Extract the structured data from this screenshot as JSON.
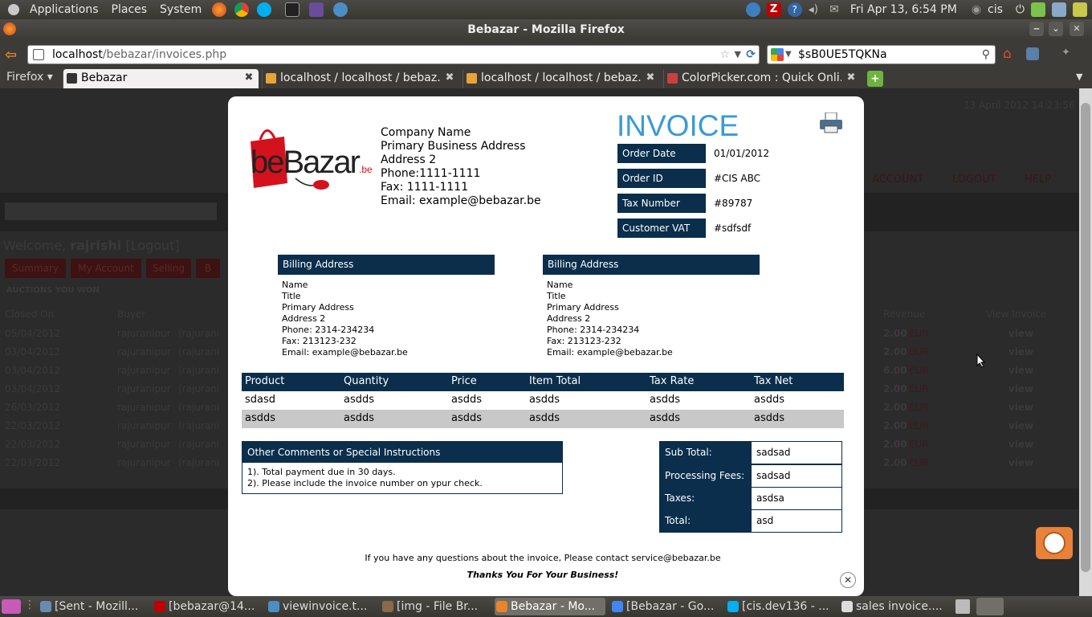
{
  "gnome_panel": {
    "menus": [
      "Applications",
      "Places",
      "System"
    ],
    "datetime": "Fri Apr 13,  6:54 PM",
    "user": "cis"
  },
  "window": {
    "title": "Bebazar - Mozilla Firefox"
  },
  "navbar": {
    "url_host": "localhost",
    "url_path": "/bebazar/invoices.php",
    "search_value": "$sB0UE5TQKNa"
  },
  "tabs": {
    "firefox_menu": "Firefox",
    "items": [
      {
        "label": "Bebazar"
      },
      {
        "label": "localhost / localhost / bebaz..."
      },
      {
        "label": "localhost / localhost / bebaz..."
      },
      {
        "label": "ColorPicker.com : Quick Onli..."
      }
    ]
  },
  "background_page": {
    "datetime": "13 April 2012 14:23:56",
    "welcome_prefix": "Welcome, ",
    "user": "rajrishi",
    "logout": "[Logout]",
    "nav": [
      "ACCOUNT",
      "LOGOUT",
      "HELP"
    ],
    "subtabs": [
      "Summary",
      "My Account",
      "Selling",
      "B"
    ],
    "section": "AUCTIONS YOU WON",
    "columns": [
      "Closed On",
      "Buyer",
      "Revenue",
      "View Invoice"
    ],
    "rows": [
      {
        "date": "05/04/2012",
        "buyer": "rajuranipur",
        "buyer2": "(rajurani",
        "revenue": "2.00",
        "cur": "EUR",
        "view": "view"
      },
      {
        "date": "03/04/2012",
        "buyer": "rajuranipur",
        "buyer2": "(rajurani",
        "revenue": "2.00",
        "cur": "EUR",
        "view": "view"
      },
      {
        "date": "03/04/2012",
        "buyer": "rajuranipur",
        "buyer2": "(rajurani",
        "revenue": "6.00",
        "cur": "EUR",
        "view": "view"
      },
      {
        "date": "03/04/2012",
        "buyer": "rajuranipur",
        "buyer2": "(rajurani",
        "revenue": "2.00",
        "cur": "EUR",
        "view": "view"
      },
      {
        "date": "26/03/2012",
        "buyer": "rajuranipur",
        "buyer2": "(rajurani",
        "revenue": "2.00",
        "cur": "EUR",
        "view": "view"
      },
      {
        "date": "22/03/2012",
        "buyer": "rajuranipur",
        "buyer2": "(rajurani",
        "revenue": "2.00",
        "cur": "EUR",
        "view": "view"
      },
      {
        "date": "22/03/2012",
        "buyer": "rajuranipur",
        "buyer2": "(rajurani",
        "revenue": "2.00",
        "cur": "EUR",
        "view": "view"
      },
      {
        "date": "22/03/2012",
        "buyer": "rajuranipur",
        "buyer2": "(rajurani",
        "revenue": "2.00",
        "cur": "EUR",
        "view": "view"
      }
    ]
  },
  "invoice": {
    "logo_text": "beBazar",
    "logo_suffix": ".be",
    "company_lines": [
      "Company Name",
      "Primary Business Address",
      "Address 2",
      "Phone:1111-1111",
      "Fax: 1111-1111",
      "Email: example@bebazar.be"
    ],
    "heading": "INVOICE",
    "meta": [
      {
        "label": "Order Date",
        "value": "01/01/2012"
      },
      {
        "label": "Order ID",
        "value": "#CIS ABC"
      },
      {
        "label": "Tax Number",
        "value": "#89787"
      },
      {
        "label": "Customer VAT",
        "value": "#sdfsdf"
      }
    ],
    "billing_left": {
      "title": "Billing Address",
      "lines": [
        "Name",
        "Title",
        "Primary Address",
        "Address 2",
        "Phone: 2314-234234",
        "Fax: 213123-232",
        "Email: example@bebazar.be"
      ]
    },
    "billing_right": {
      "title": "Billing Address",
      "lines": [
        "Name",
        "Title",
        "Primary Address",
        "Address 2",
        "Phone: 2314-234234",
        "Fax: 213123-232",
        "Email: example@bebazar.be"
      ]
    },
    "items_headers": [
      "Product",
      "Quantity",
      "Price",
      "Item Total",
      "Tax Rate",
      "Tax Net"
    ],
    "items_rows": [
      [
        "sdasd",
        "asdds",
        "asdds",
        "asdds",
        "asdds",
        "asdds"
      ],
      [
        "asdds",
        "asdds",
        "asdds",
        "asdds",
        "asdds",
        "asdds"
      ]
    ],
    "comments": {
      "title": "Other Comments or Special Instructions",
      "lines": [
        "1). Total payment due in 30 days.",
        "2). Please include the invoice number on ypur check."
      ]
    },
    "totals": [
      {
        "label": "Sub Total:",
        "value": "sadsad"
      },
      {
        "label": "Processing Fees:",
        "value": "sadsad"
      },
      {
        "label": "Taxes:",
        "value": "asdsa"
      },
      {
        "label": "Total:",
        "value": "asd"
      }
    ],
    "footer_contact": "If you have any questions about the invoice, Please contact service@bebazar.be",
    "footer_thanks": "Thanks You For Your Business!"
  },
  "taskbar": {
    "items": [
      {
        "label": "[Sent - Mozill..."
      },
      {
        "label": "[bebazar@14..."
      },
      {
        "label": "viewinvoice.t..."
      },
      {
        "label": "[img - File Br..."
      },
      {
        "label": "Bebazar - Mo..."
      },
      {
        "label": "[Bebazar - Go..."
      },
      {
        "label": "[cis.dev136 - ..."
      },
      {
        "label": "sales invoice...."
      }
    ]
  }
}
